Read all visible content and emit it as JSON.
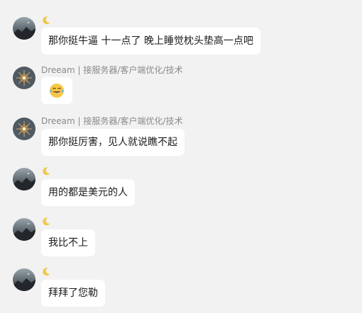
{
  "chat": {
    "messages": [
      {
        "sender": "",
        "avatar": "night-sky-avatar",
        "badge": "crescent-moon-icon",
        "text": "那你挺牛逼  十一点了 晚上睡觉枕头垫高一点吧"
      },
      {
        "sender": "Dreeam | 接服务器/客户端优化/技术",
        "avatar": "sparkler-avatar",
        "emoji": "face-with-tears-of-joy-icon"
      },
      {
        "sender": "Dreeam | 接服务器/客户端优化/技术",
        "avatar": "sparkler-avatar",
        "text": "那你挺厉害，见人就说瞧不起"
      },
      {
        "sender": "",
        "avatar": "night-sky-avatar",
        "badge": "crescent-moon-icon",
        "text": "用的都是美元的人"
      },
      {
        "sender": "",
        "avatar": "night-sky-avatar",
        "badge": "crescent-moon-icon",
        "text": "我比不上"
      },
      {
        "sender": "",
        "avatar": "night-sky-avatar",
        "badge": "crescent-moon-icon",
        "text": "拜拜了您勒"
      }
    ]
  },
  "colors": {
    "background": "#f2f2f2",
    "bubble": "#ffffff",
    "sender_text": "#8a8a8a",
    "message_text": "#1a1a1a",
    "moon": "#f1c84b"
  }
}
